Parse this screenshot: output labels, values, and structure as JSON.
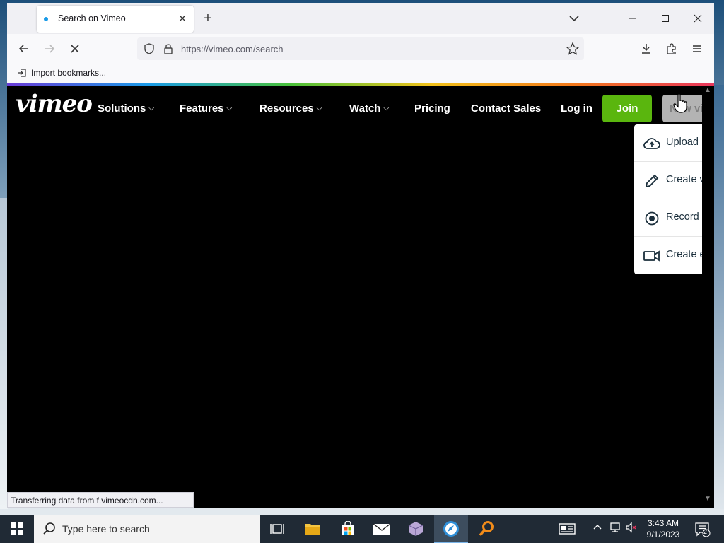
{
  "browser": {
    "tab_title": "Search on Vimeo",
    "url": "https://vimeo.com/search",
    "bookmark_item": "Import bookmarks...",
    "status_text": "Transferring data from f.vimeocdn.com..."
  },
  "vimeo": {
    "logo": "vimeo",
    "menu": {
      "solutions": "Solutions",
      "features": "Features",
      "resources": "Resources",
      "watch": "Watch",
      "pricing": "Pricing",
      "contact_sales": "Contact Sales",
      "login": "Log in"
    },
    "join_label": "Join",
    "new_video_label": "New video",
    "dropdown": {
      "upload": "Upload",
      "create_video": "Create video",
      "record": "Record",
      "create_event": "Create event"
    }
  },
  "taskbar": {
    "search_placeholder": "Type here to search",
    "time": "3:43 AM",
    "date": "9/1/2023",
    "notification_count": "2"
  },
  "colors": {
    "join_green": "#5ab60e",
    "vimeo_black": "#000000",
    "taskbar": "#202a35"
  }
}
